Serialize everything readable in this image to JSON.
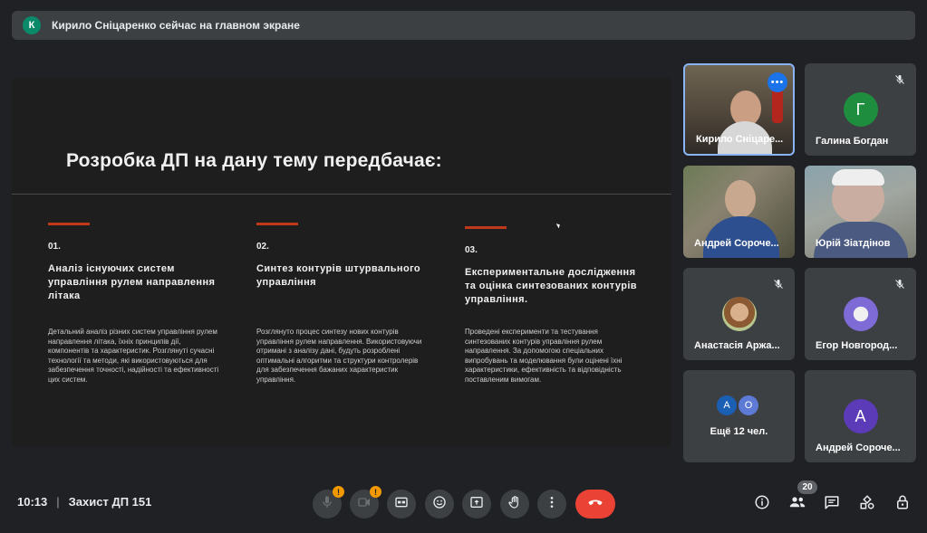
{
  "banner": {
    "initial": "К",
    "text": "Кирило Сніцаренко сейчас на главном экране"
  },
  "slide": {
    "title": "Розробка ДП на дану тему передбачає:",
    "columns": [
      {
        "number": "01.",
        "heading": "Аналіз існуючих систем управління рулем направлення літака",
        "body": "Детальний аналіз різних систем управління рулем направлення літака, їхніх принципів дії, компонентів та характеристик. Розглянуті сучасні технології та методи, які використовуються для забезпечення точності, надійності та ефективності цих систем."
      },
      {
        "number": "02.",
        "heading": "Синтез контурів штурвального управління",
        "body": "Розглянуто процес синтезу нових контурів управління рулем направлення. Використовуючи отримані з аналізу дані, будуть розроблені оптимальні алгоритми та структури контролерів для забезпечення бажаних характеристик управління."
      },
      {
        "number": "03.",
        "heading": "Експериментальне дослідження та оцінка синтезованих контурів управління.",
        "body": "Проведені експерименти та тестування синтезованих контурів управління рулем направлення. За допомогою спеціальних випробувань та моделювання були оцінені їхні характеристики, ефективність та відповідність поставленим вимогам."
      }
    ]
  },
  "participants": [
    {
      "name": "Кирило Сніцаре...",
      "type": "video"
    },
    {
      "name": "Галина Богдан",
      "initial": "Г",
      "color": "#1e8e3e"
    },
    {
      "name": "Андрей Сороче...",
      "type": "video"
    },
    {
      "name": "Юрій Зіатдінов",
      "type": "video"
    },
    {
      "name": "Анастасія Аржа...",
      "type": "photo"
    },
    {
      "name": "Егор Новгород...",
      "type": "photo"
    },
    {
      "name": "Ещё 12 чел.",
      "initials": [
        "А",
        "О"
      ]
    },
    {
      "name": "Андрей Сороче...",
      "initial": "А",
      "color": "#5b3bb8"
    }
  ],
  "meeting": {
    "time": "10:13",
    "separator": "|",
    "title": "Захист ДП 151"
  },
  "controls": {
    "warning_mark": "!",
    "participants_count": "20"
  },
  "icons": [
    "microphone-icon",
    "camera-icon",
    "captions-icon",
    "emoji-icon",
    "present-icon",
    "raise-hand-icon",
    "more-icon",
    "hang-up-icon",
    "info-icon",
    "people-icon",
    "chat-icon",
    "activities-icon",
    "host-controls-icon",
    "mic-off-icon"
  ]
}
